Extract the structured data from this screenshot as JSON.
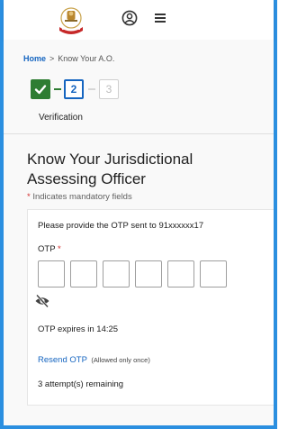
{
  "header": {
    "logo": "income-tax-department-emblem",
    "icons": [
      "profile-icon",
      "menu-icon"
    ]
  },
  "breadcrumb": {
    "home": "Home",
    "separator": ">",
    "current": "Know Your A.O."
  },
  "stepper": {
    "steps": [
      {
        "label": "✔",
        "status": "completed"
      },
      {
        "label": "2",
        "status": "active"
      },
      {
        "label": "3",
        "status": "pending"
      }
    ],
    "current_label": "Verification"
  },
  "page": {
    "title": "Know Your Jurisdictional Assessing Officer",
    "mandatory_asterisk": "*",
    "mandatory_note": "Indicates mandatory fields"
  },
  "otp": {
    "instruction": "Please provide the OTP sent to 91xxxxxx17",
    "label": "OTP",
    "required_marker": "*",
    "box_count": 6,
    "values": [
      "",
      "",
      "",
      "",
      "",
      ""
    ],
    "visibility_icon": "eye-slash-icon",
    "expiry": "OTP expires in 14:25",
    "resend_label": "Resend OTP",
    "resend_note": "(Allowed only once)",
    "attempts": "3 attempt(s) remaining"
  },
  "colors": {
    "accent": "#1565c0",
    "success": "#2e7d32",
    "required": "#d32f2f",
    "frame": "#2b8fe0"
  }
}
